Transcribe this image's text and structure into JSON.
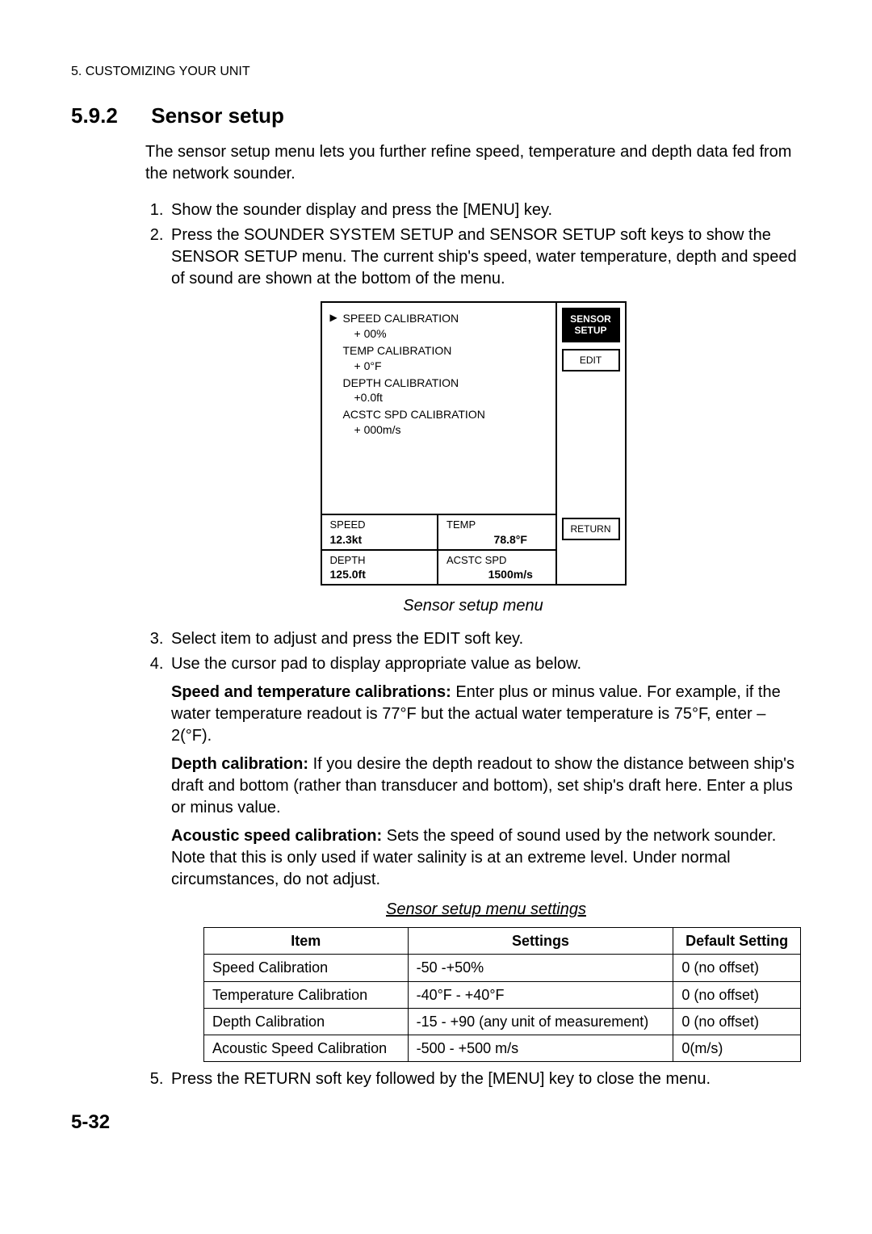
{
  "running_head": "5. CUSTOMIZING YOUR UNIT",
  "section": {
    "number": "5.9.2",
    "title": "Sensor setup"
  },
  "intro": "The sensor setup menu lets you further refine speed, temperature and depth data fed from the network sounder.",
  "steps_a": {
    "s1": "Show the sounder display and press the [MENU] key.",
    "s2": "Press the SOUNDER SYSTEM SETUP and SENSOR SETUP soft keys to show the SENSOR SETUP menu. The current ship's speed, water temperature, depth and speed of sound are shown at the bottom of the menu."
  },
  "figure": {
    "calib": {
      "speed": {
        "label": "SPEED CALIBRATION",
        "value": "+ 00%"
      },
      "temp": {
        "label": "TEMP  CALIBRATION",
        "value": "+ 0°F"
      },
      "depth": {
        "label": "DEPTH CALIBRATION",
        "value": "+0.0ft"
      },
      "acstc": {
        "label": "ACSTC SPD CALIBRATION",
        "value": "+ 000m/s"
      }
    },
    "status": {
      "speed": {
        "label": "SPEED",
        "value": "12.3kt"
      },
      "temp": {
        "label": "TEMP",
        "value": "78.8°F"
      },
      "depth": {
        "label": "DEPTH",
        "value": "125.0ft"
      },
      "acstc": {
        "label": "ACSTC SPD",
        "value": "1500m/s"
      }
    },
    "softkeys": {
      "header": "SENSOR SETUP",
      "edit": "EDIT",
      "return": "RETURN"
    },
    "caption": "Sensor setup menu"
  },
  "steps_b": {
    "s3": "Select item to adjust and press the EDIT soft key.",
    "s4": "Use the cursor pad to display appropriate value as below.",
    "s5": "Press the RETURN soft key followed by the [MENU] key to close the menu."
  },
  "paras": {
    "speed_temp": {
      "lead": "Speed and temperature calibrations:",
      "body": " Enter plus or minus value. For example, if the water temperature readout is 77°F but the actual water temperature is 75°F, enter –2(°F)."
    },
    "depth": {
      "lead": "Depth calibration:",
      "body": " If you desire the depth readout to show the distance between ship's draft and bottom (rather than transducer and bottom), set ship's draft here. Enter a plus or minus value."
    },
    "acoustic": {
      "lead": "Acoustic speed calibration:",
      "body": " Sets the speed of sound used by the network sounder. Note that this is only used if water salinity is at an extreme level. Under normal circumstances, do not adjust."
    }
  },
  "table": {
    "caption": "Sensor setup menu settings",
    "headers": {
      "item": "Item",
      "settings": "Settings",
      "default": "Default Setting"
    },
    "rows": [
      {
        "item": "Speed Calibration",
        "settings": "-50 -+50%",
        "default": "0 (no offset)"
      },
      {
        "item": "Temperature Calibration",
        "settings": "-40°F - +40°F",
        "default": "0 (no offset)"
      },
      {
        "item": "Depth Calibration",
        "settings": "-15 - +90 (any unit of measurement)",
        "default": "0 (no offset)"
      },
      {
        "item": "Acoustic Speed Calibration",
        "settings": "-500 - +500 m/s",
        "default": "0(m/s)"
      }
    ]
  },
  "page_number": "5-32"
}
